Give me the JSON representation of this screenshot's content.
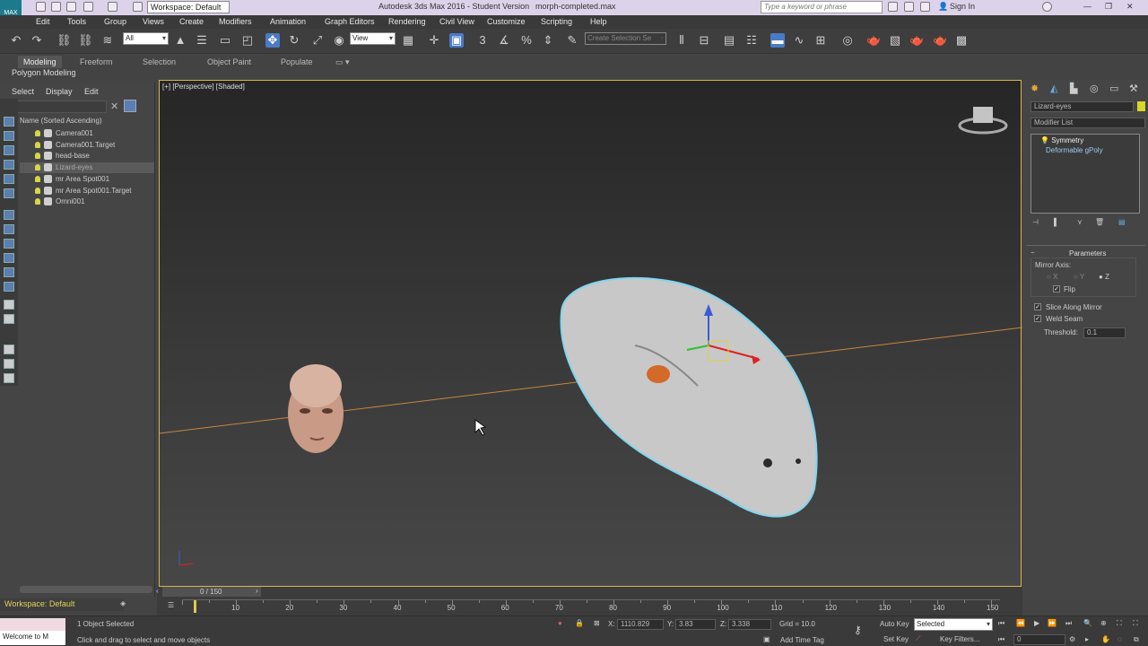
{
  "titlebar": {
    "workspace": "Workspace: Default",
    "title": "Autodesk 3ds Max 2016 - Student Version",
    "filename": "morph-completed.max",
    "search_placeholder": "Type a keyword or phrase",
    "sign_in": "Sign In"
  },
  "menu": [
    "Edit",
    "Tools",
    "Group",
    "Views",
    "Create",
    "Modifiers",
    "Animation",
    "Graph Editors",
    "Rendering",
    "Civil View",
    "Customize",
    "Scripting",
    "Help"
  ],
  "toolbar": {
    "filter_value": "All",
    "view_value": "View",
    "selection_set_placeholder": "Create Selection Se"
  },
  "ribbon": {
    "tabs": [
      "Modeling",
      "Freeform",
      "Selection",
      "Object Paint",
      "Populate"
    ],
    "subtab": "Polygon Modeling"
  },
  "scene_explorer": {
    "tabs": [
      "Select",
      "Display",
      "Edit"
    ],
    "column_header": "Name (Sorted Ascending)",
    "items": [
      "Camera001",
      "Camera001.Target",
      "head-base",
      "Lizard-eyes",
      "mr Area Spot001",
      "mr Area Spot001.Target",
      "Omni001"
    ],
    "selected_index": 3
  },
  "viewport": {
    "label": "[+] [Perspective] [Shaded]"
  },
  "command_panel": {
    "object_name": "Lizard-eyes",
    "object_color": "#d6d62a",
    "modifier_list": "Modifier List",
    "stack": [
      "Symmetry",
      "Deformable gPoly"
    ],
    "rollout_title": "Parameters",
    "mirror_axis_label": "Mirror Axis:",
    "axes": [
      "X",
      "Y",
      "Z"
    ],
    "selected_axis": "Z",
    "flip_label": "Flip",
    "slice_label": "Slice Along Mirror",
    "weld_label": "Weld Seam",
    "threshold_label": "Threshold:",
    "threshold_value": "0.1"
  },
  "timeline": {
    "frame_display": "0 / 150",
    "ticks": [
      "10",
      "20",
      "30",
      "40",
      "50",
      "60",
      "70",
      "80",
      "90",
      "100",
      "110",
      "120",
      "130",
      "140",
      "150"
    ]
  },
  "status": {
    "workspace": "Workspace: Default",
    "maxscript": "Welcome to M",
    "selection": "1 Object Selected",
    "prompt": "Click and drag to select and move objects",
    "x_label": "X:",
    "x_value": "1110.829",
    "y_label": "Y:",
    "y_value": "3.83",
    "z_label": "Z:",
    "z_value": "3.338",
    "grid": "Grid = 10.0",
    "add_time_tag": "Add Time Tag",
    "auto_key": "Auto Key",
    "selected": "Selected",
    "set_key": "Set Key",
    "key_filters": "Key Filters...",
    "current_frame": "0"
  }
}
